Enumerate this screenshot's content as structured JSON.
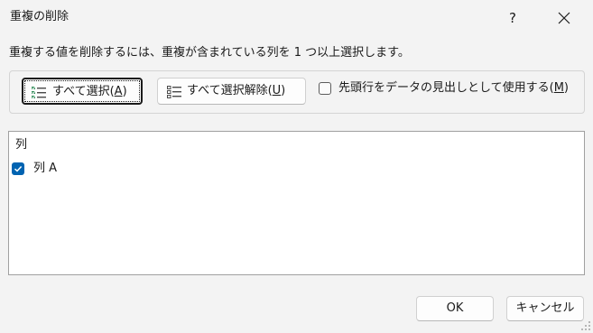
{
  "window": {
    "title": "重複の削除",
    "help_label": "?"
  },
  "instruction": "重複する値を削除するには、重複が含まれている列を 1 つ以上選択します。",
  "options": {
    "select_all": {
      "text": "すべて選択(",
      "key": "A",
      "close": ")"
    },
    "deselect_all": {
      "text": "すべて選択解除(",
      "key": "U",
      "close": ")"
    },
    "has_headers": {
      "text": "先頭行をデータの見出しとして使用する(",
      "key": "M",
      "close": ")",
      "checked": false
    }
  },
  "columns_list": {
    "header": "列",
    "items": [
      {
        "label": "列 A",
        "checked": true
      }
    ]
  },
  "footer": {
    "ok_label": "OK",
    "cancel_label": "キャンセル"
  },
  "colors": {
    "accent": "#0063b1",
    "background": "#f3f3f3"
  }
}
